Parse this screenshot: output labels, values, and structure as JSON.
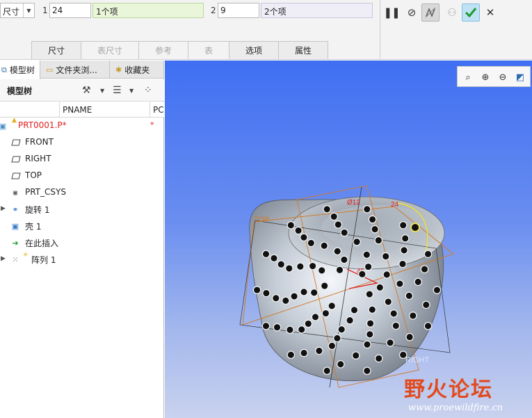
{
  "dashboard": {
    "dim_select": "尺寸",
    "row1": {
      "index": "1",
      "value": "24",
      "collector": "1个项"
    },
    "row2": {
      "index": "2",
      "value": "9",
      "collector": "2个项"
    },
    "controls": [
      "pause-icon",
      "no-preview-icon",
      "feature-preview-icon",
      "glasses-icon",
      "checkmark-icon",
      "close-icon"
    ],
    "tabs": [
      {
        "label": "尺寸",
        "enabled": true
      },
      {
        "label": "表尺寸",
        "enabled": false
      },
      {
        "label": "参考",
        "enabled": false
      },
      {
        "label": "表",
        "enabled": false
      },
      {
        "label": "选项",
        "enabled": true
      },
      {
        "label": "属性",
        "enabled": true
      }
    ]
  },
  "panel": {
    "tabs": [
      "模型树",
      "文件夹浏...",
      "收藏夹"
    ],
    "title": "模型树",
    "columns": {
      "name": "PNAME",
      "third": "PC"
    },
    "tree": [
      {
        "label": "PRT0001.P*",
        "icon": "part-icon",
        "marker": "*"
      },
      {
        "label": "FRONT",
        "icon": "datum-plane-icon"
      },
      {
        "label": "RIGHT",
        "icon": "datum-plane-icon"
      },
      {
        "label": "TOP",
        "icon": "datum-plane-icon"
      },
      {
        "label": "PRT_CSYS",
        "icon": "csys-icon"
      },
      {
        "label": "旋转 1",
        "icon": "revolve-icon"
      },
      {
        "label": "壳 1",
        "icon": "shell-icon"
      },
      {
        "label": "在此插入",
        "icon": "insert-here-icon"
      },
      {
        "label": "阵列 1",
        "icon": "pattern-icon"
      }
    ]
  },
  "viewport": {
    "view_buttons": [
      "refit-icon",
      "zoom-in-icon",
      "zoom-out-icon",
      "repaint-icon"
    ],
    "labels": {
      "top": "TOP",
      "right": "RIGHT",
      "dim1": "Ø12",
      "dim2": "24",
      "dim3": "45"
    },
    "watermark": {
      "cn": "野火论坛",
      "url": "www.proewildfire.cn"
    }
  },
  "colors": {
    "accent_ok": "#bfe3f5",
    "tree_active": "#e02020",
    "viewport_top": "#3f6ff2",
    "viewport_bottom": "#c9d2ee"
  }
}
